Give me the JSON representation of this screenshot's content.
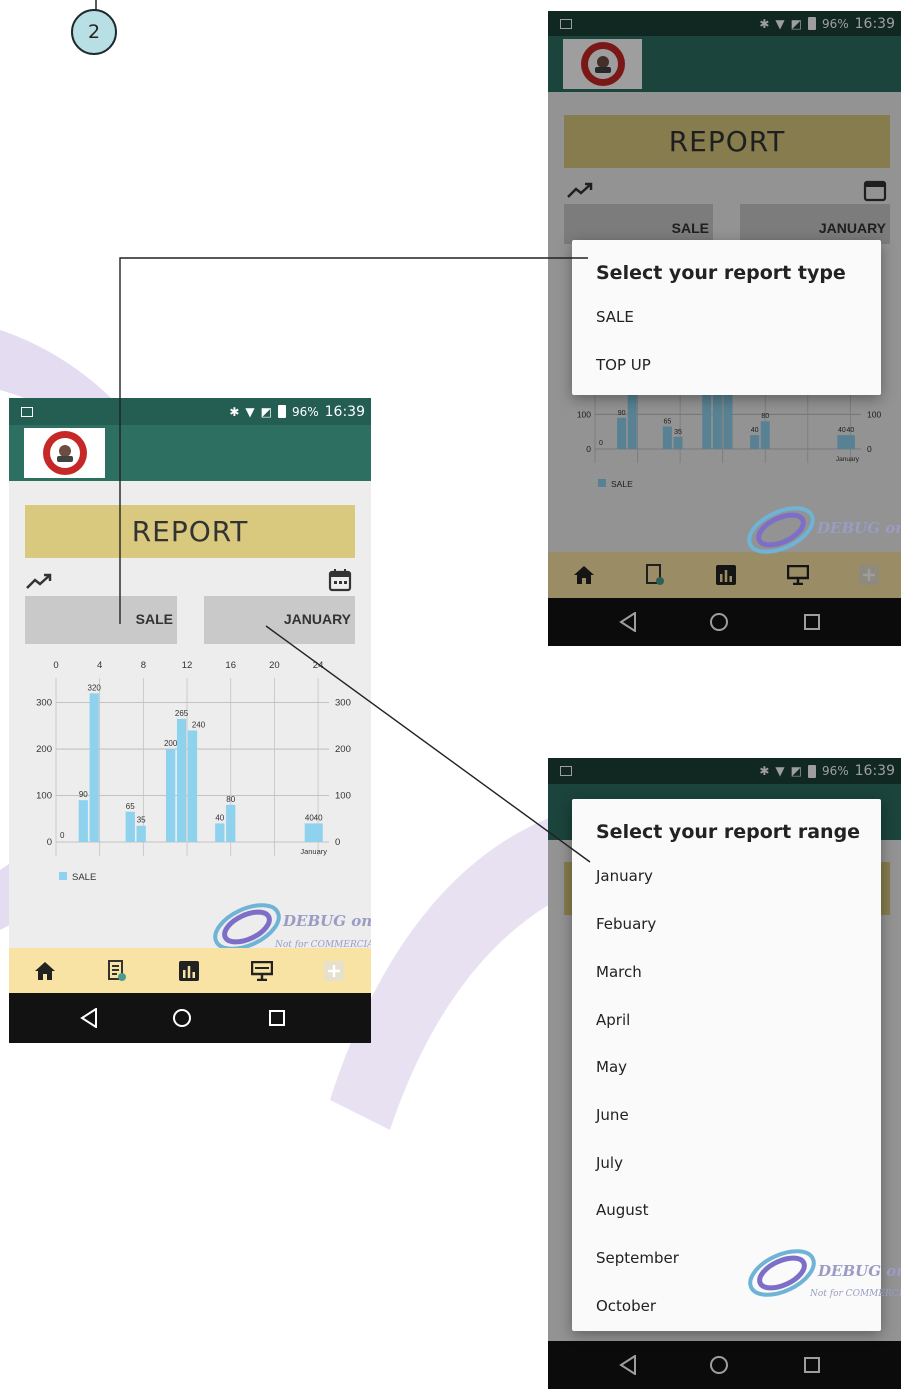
{
  "step_number": "2",
  "status_bar": {
    "battery": "96%",
    "time": "16:39"
  },
  "app": {
    "logo_alt": "Grand Coffee Boy logo",
    "report_title": "REPORT"
  },
  "selectors": {
    "type_value": "SALE",
    "range_value": "JANUARY"
  },
  "chart_data": {
    "type": "bar",
    "series": [
      {
        "name": "SALE",
        "color": "#8ed2ee",
        "x": [
          0,
          4,
          8,
          12,
          16,
          20,
          24
        ]
      }
    ],
    "bars": [
      {
        "x": 2.5,
        "value": 90
      },
      {
        "x": 3.5,
        "value": 320
      },
      {
        "x": 6.8,
        "value": 65
      },
      {
        "x": 7.8,
        "value": 35
      },
      {
        "x": 10.5,
        "value": 200
      },
      {
        "x": 11.5,
        "value": 265
      },
      {
        "x": 12.5,
        "value": 240
      },
      {
        "x": 15,
        "value": 40
      },
      {
        "x": 16,
        "value": 80
      },
      {
        "x": 23.2,
        "value": 40
      },
      {
        "x": 24.0,
        "value": 40
      }
    ],
    "zero_label": "0",
    "x_ticks": [
      "0",
      "4",
      "8",
      "12",
      "16",
      "20",
      "24"
    ],
    "y_ticks": [
      "0",
      "100",
      "200",
      "300"
    ],
    "ylim": [
      0,
      340
    ],
    "xlim": [
      0,
      25
    ],
    "bottom_label": "January",
    "legend": "SALE",
    "legend_position": "bottom-left"
  },
  "watermark": {
    "line1": "DEBUG only",
    "line2": "Not for COMMERCIAL"
  },
  "type_dialog": {
    "title": "Select your report type",
    "options": [
      "SALE",
      "TOP UP"
    ]
  },
  "range_dialog": {
    "title": "Select your report range",
    "options": [
      "January",
      "Febuary",
      "March",
      "April",
      "May",
      "June",
      "July",
      "August",
      "September",
      "October"
    ]
  },
  "icons": {
    "nav": [
      "home-icon",
      "report-list-icon",
      "bar-chart-icon",
      "monitor-icon",
      "add-icon"
    ],
    "system": [
      "back-icon",
      "home-circle-icon",
      "recents-icon"
    ]
  }
}
